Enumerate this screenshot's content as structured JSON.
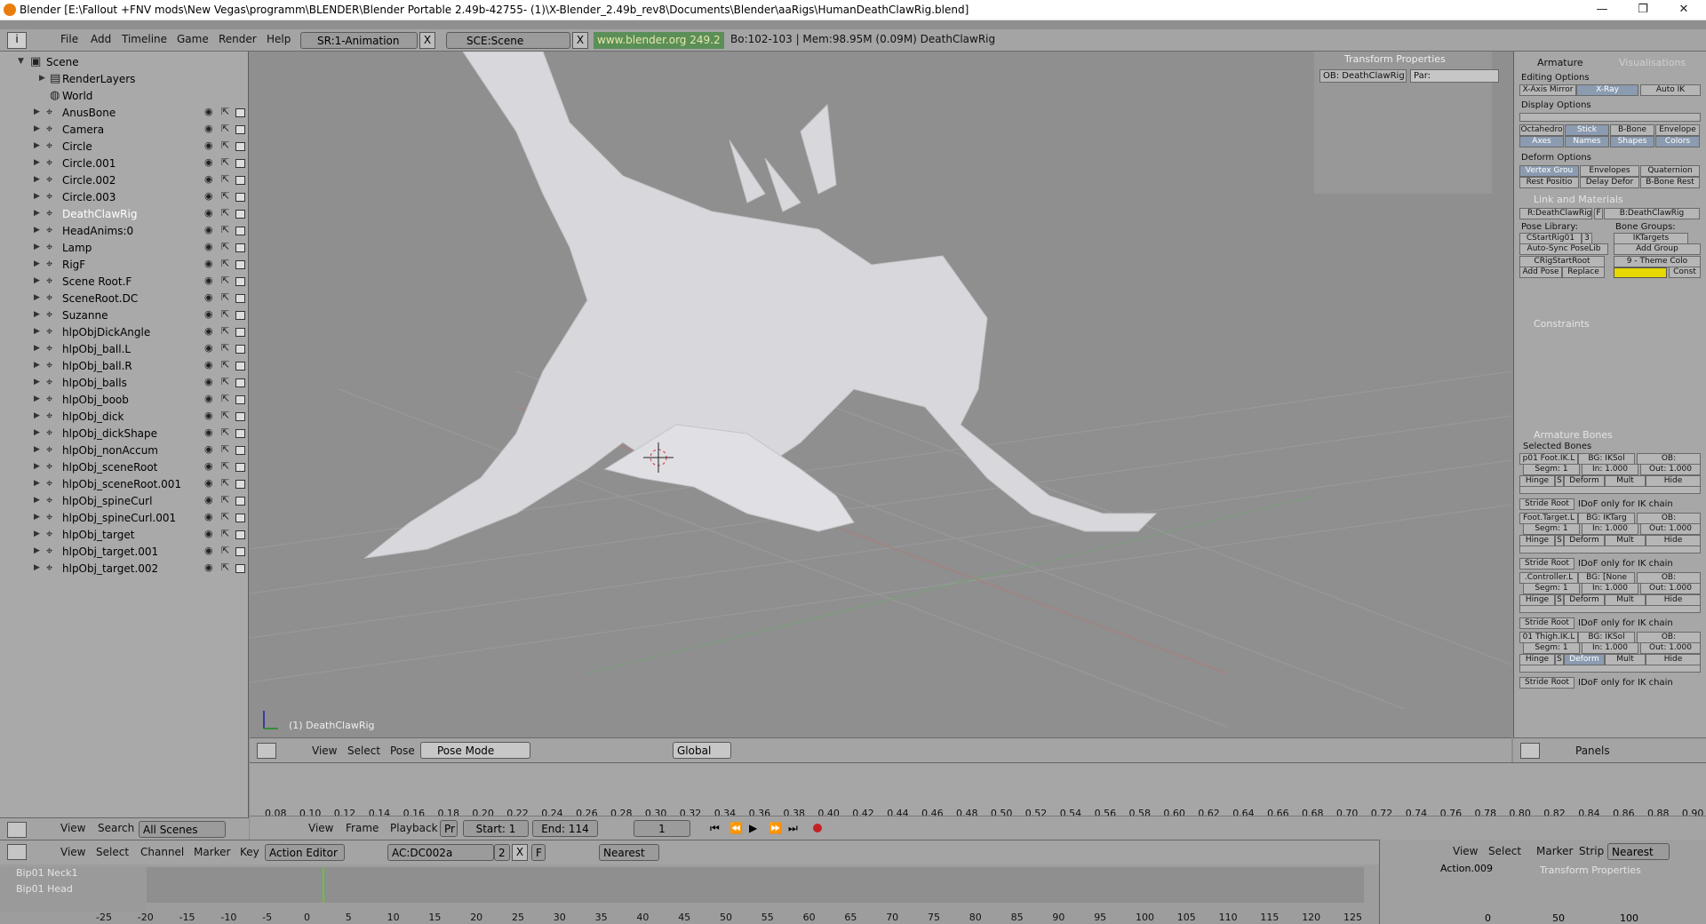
{
  "window": {
    "title": "Blender [E:\\Fallout +FNV mods\\New Vegas\\programm\\BLENDER\\Blender Portable 2.49b-42755- (1)\\X-Blender_2.49b_rev8\\Documents\\Blender\\aaRigs\\HumanDeathClawRig.blend]",
    "minimize": "—",
    "maximize": "❐",
    "close": "✕"
  },
  "menubar": {
    "items": [
      "File",
      "Add",
      "Timeline",
      "Game",
      "Render",
      "Help"
    ],
    "screen": "SR:1-Animation",
    "scene": "SCE:Scene",
    "url": "www.blender.org 249.2",
    "stats": "Bo:102-103 | Mem:98.95M (0.09M) DeathClawRig",
    "close_glyph": "X"
  },
  "outliner": {
    "root": "Scene",
    "renderlayers": "RenderLayers",
    "world": "World",
    "objects": [
      "AnusBone",
      "Camera",
      "Circle",
      "Circle.001",
      "Circle.002",
      "Circle.003",
      "DeathClawRig",
      "HeadAnims:0",
      "Lamp",
      "RigF",
      "Scene Root.F",
      "SceneRoot.DC",
      "Suzanne",
      "hlpObjDickAngle",
      "hlpObj_ball.L",
      "hlpObj_ball.R",
      "hlpObj_balls",
      "hlpObj_boob",
      "hlpObj_dick",
      "hlpObj_dickShape",
      "hlpObj_nonAccum",
      "hlpObj_sceneRoot",
      "hlpObj_sceneRoot.001",
      "hlpObj_spineCurl",
      "hlpObj_spineCurl.001",
      "hlpObj_target",
      "hlpObj_target.001",
      "hlpObj_target.002"
    ],
    "footer": {
      "view": "View",
      "search": "Search",
      "scenes": "All Scenes"
    }
  },
  "viewport": {
    "object_label": "(1) DeathClawRig",
    "transform_title": "Transform Properties",
    "ob": "OB: DeathClawRig",
    "par": "Par:",
    "header": {
      "view": "View",
      "select": "Select",
      "pose": "Pose",
      "mode": "Pose Mode",
      "orientation": "Global"
    }
  },
  "props": {
    "tab_armature": "Armature",
    "tab_vis": "Visualisations",
    "editing": "Editing Options",
    "xaxis": "X-Axis Mirror",
    "xray": "X-Ray",
    "autoik": "Auto IK",
    "display": "Display Options",
    "disp_btns": [
      "Octahedro",
      "Stick",
      "B-Bone",
      "Envelope"
    ],
    "disp_btns2": [
      "Axes",
      "Names",
      "Shapes",
      "Colors"
    ],
    "deform": "Deform Options",
    "def_btns": [
      "Vertex Grou",
      "Envelopes",
      "Quaternion"
    ],
    "def_btns2": [
      "Rest Positio",
      "Delay Defor",
      "B-Bone Rest"
    ],
    "link": "Link and Materials",
    "r": "R:DeathClawRig",
    "f": "F",
    "b": "B:DeathClawRig",
    "poselib": "Pose Library:",
    "bonegroups": "Bone Groups:",
    "cstart": "CStartRig01",
    "cstart_n": "3",
    "iktargets": "IKTargets",
    "autosync": "Auto-Sync PoseLib",
    "addgroup": "Add Group",
    "crig": "CRigStartRoot",
    "theme": "9 - Theme Colo",
    "addpose": "Add Pose",
    "replace": "Replace",
    "const": "Const",
    "constraints": "Constraints",
    "armbones": "Armature Bones",
    "selbones": "Selected Bones",
    "bones": [
      {
        "name": "p01 Foot.IK.L",
        "bg": "BG: IKSol"
      },
      {
        "name": "Foot.Target.L",
        "bg": "BG: IKTarg"
      },
      {
        "name": ".Controller.L",
        "bg": "BG: [None"
      },
      {
        "name": "01 Thigh.IK.L",
        "bg": "BG: IKSol"
      }
    ],
    "ob": "OB:",
    "segm": "Segm: 1",
    "in": "In: 1.000",
    "out": "Out: 1.000",
    "hinge": "Hinge",
    "s": "S",
    "deform_b": "Deform",
    "mult": "Mult",
    "hide": "Hide",
    "stride": "Stride Root",
    "idof": "IDoF only for IK chain",
    "header_panels": "Panels"
  },
  "timeline": {
    "ticks": [
      "0.08",
      "0.10",
      "0.12",
      "0.14",
      "0.16",
      "0.18",
      "0.20",
      "0.22",
      "0.24",
      "0.26",
      "0.28",
      "0.30",
      "0.32",
      "0.34",
      "0.36",
      "0.38",
      "0.40",
      "0.42",
      "0.44",
      "0.46",
      "0.48",
      "0.50",
      "0.52",
      "0.54",
      "0.56",
      "0.58",
      "0.60",
      "0.62",
      "0.64",
      "0.66",
      "0.68",
      "0.70",
      "0.72",
      "0.74",
      "0.76",
      "0.78",
      "0.80",
      "0.82",
      "0.84",
      "0.86",
      "0.88",
      "0.90"
    ],
    "header": {
      "view": "View",
      "frame": "Frame",
      "playback": "Playback",
      "pr": "Pr",
      "start": "Start: 1",
      "end": "End: 114",
      "current": "1"
    }
  },
  "action": {
    "header": {
      "view": "View",
      "select": "Select",
      "channel": "Channel",
      "marker": "Marker",
      "key": "Key",
      "editor": "Action Editor",
      "ac": "AC:DC002a",
      "users": "2",
      "f": "F",
      "snap": "Nearest"
    },
    "channels": [
      "Bip01 Neck1",
      "Bip01 Head"
    ],
    "ticks": [
      "-25",
      "-20",
      "-15",
      "-10",
      "-5",
      "0",
      "5",
      "10",
      "15",
      "20",
      "25",
      "30",
      "35",
      "40",
      "45",
      "50",
      "55",
      "60",
      "65",
      "70",
      "75",
      "80",
      "85",
      "90",
      "95",
      "100",
      "105",
      "110",
      "115",
      "120",
      "125"
    ]
  },
  "nla": {
    "header": {
      "view": "View",
      "select": "Select",
      "marker": "Marker",
      "strip": "Strip",
      "snap": "Nearest"
    },
    "action": "Action.009",
    "transform": "Transform Properties",
    "ticks": [
      "0",
      "50",
      "100"
    ]
  },
  "colors": {
    "bg": "#8f8f8f",
    "panel": "#a7a7a7",
    "selected_text": "#ffffff",
    "accent_blue": "#8b9bb0",
    "yellow": "#e6d800"
  }
}
